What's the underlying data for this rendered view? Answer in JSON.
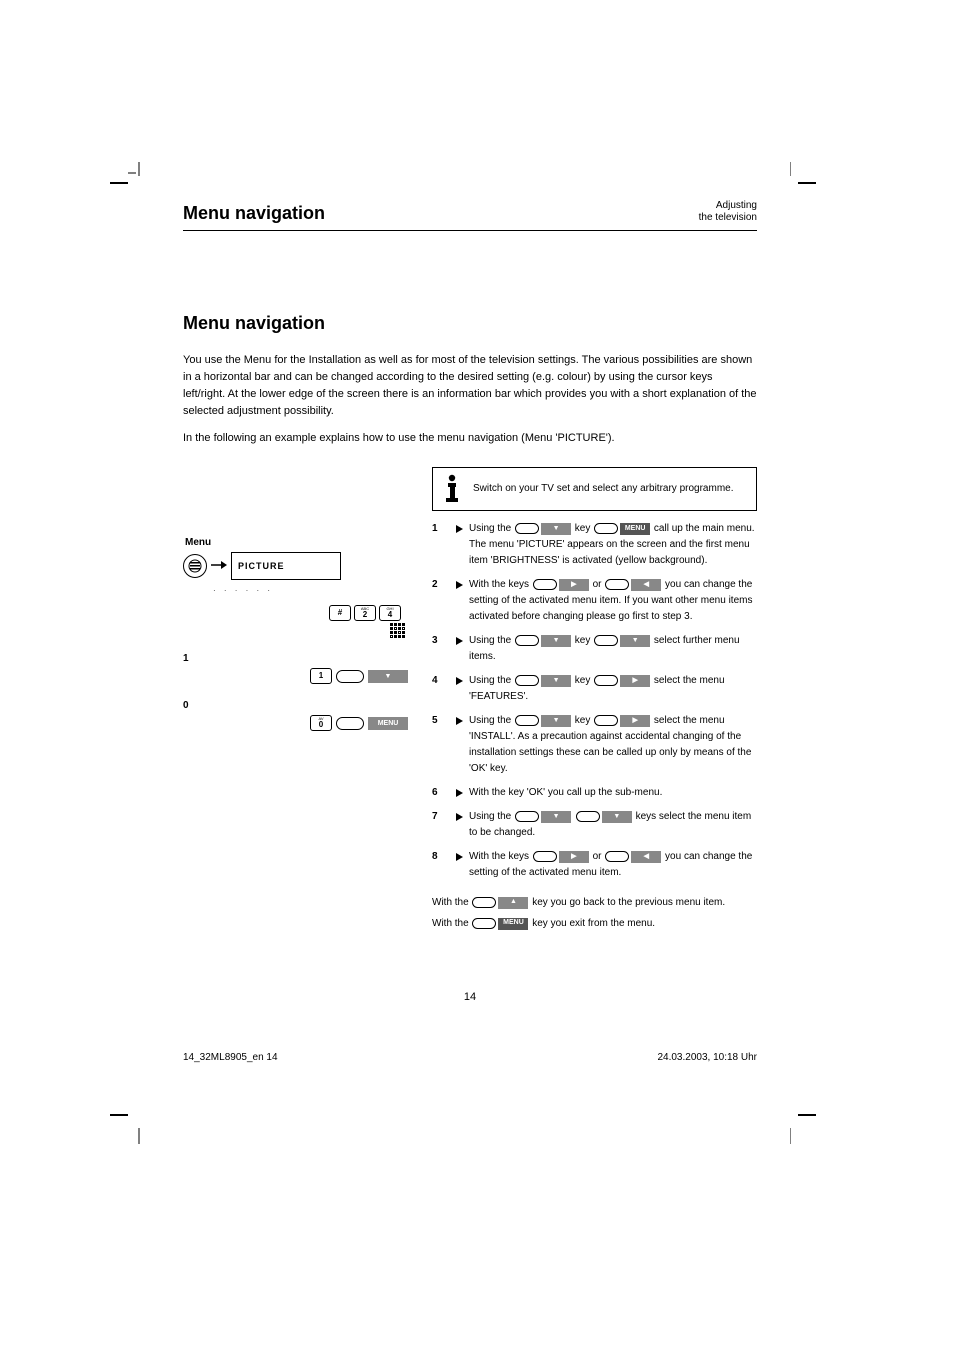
{
  "crop_marks": true,
  "heading": "Menu navigation",
  "sidebar_label_line1": "Adjusting",
  "sidebar_label_line2": "the television",
  "subsection": {
    "title": "Menu navigation",
    "para1": "You use the Menu for the Installation as well as for most of the television settings. The various possibilities are shown in a horizontal bar and can be changed according to the desired setting (e.g. colour) by using the cursor keys left/right. At the lower edge of the screen there is an information bar which provides you with a short explanation of the selected adjustment possibility.",
    "para2": "In the following an example explains how to use the menu navigation (Menu 'PICTURE')."
  },
  "left_diagram": {
    "label_menu": "Menu",
    "window_text": "PICTURE",
    "keypad_labels": [
      "#",
      "2",
      "4",
      "1",
      "0"
    ],
    "section_label_1": "1",
    "section_label_0": "0",
    "btn_label_1": "▼",
    "btn_label_0": "MENU"
  },
  "note": "Switch on your TV set and select any arbitrary programme.",
  "steps": [
    {
      "text_a": "Using the ",
      "key1": "▼",
      "text_b": " key ",
      "key2": "MENU",
      "text_c": " call up the main menu. The menu 'PICTURE' appears on the screen and the first menu item 'BRIGHTNESS' is activated (yellow background)."
    },
    {
      "text_a": "With the keys ",
      "key1": "▶",
      "text_b": " or ",
      "key2": "◀",
      "text_c": " you can change the setting of the activated menu item. If you want other menu items activated before changing please go first to step 3."
    },
    {
      "text_a": "Using the ",
      "key1": "▼",
      "text_b": " key ",
      "key2": "▼",
      "text_c": " select further menu items."
    },
    {
      "text_a": "Using the ",
      "key1": "▼",
      "text_b": " key ",
      "key2": "▶",
      "text_c": " select the menu 'FEATURES'."
    },
    {
      "text_a": "Using the ",
      "key1": "▼",
      "text_b": " key ",
      "key2": "▶",
      "text_c": " select the menu 'INSTALL'. As a precaution against accidental changing of the installation settings these can be called up only by means of the 'OK' key."
    },
    {
      "text_a": "With the key 'OK' you call up the sub-menu."
    },
    {
      "text_a": "Using the ",
      "key1": "▼",
      "text_b": " ",
      "key2": "▼",
      "text_c": " keys select the menu item to be changed."
    },
    {
      "text_a": "With the keys ",
      "key1": "▶",
      "text_b": " or ",
      "key2": "◀",
      "text_c": " you can change the setting of the activated menu item."
    }
  ],
  "back_note_a": "With the ",
  "back_note_key": "▲",
  "back_note_b": " key ",
  "back_note_label": "▲",
  "back_note_c": " you go back to the previous menu item.",
  "exit_note_a": "With the ",
  "exit_note_key": "▲",
  "exit_note_b": " key ",
  "exit_note_label": "MENU",
  "exit_note_c": " you exit from the menu.",
  "footer_left": "14_32ML8905_en  14",
  "footer_right": "24.03.2003, 10:18 Uhr",
  "page_number": "14"
}
